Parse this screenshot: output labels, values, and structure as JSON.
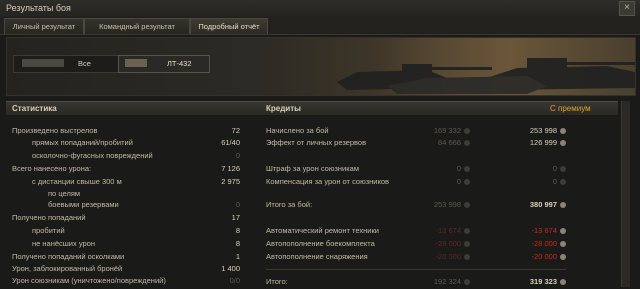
{
  "window": {
    "title": "Результаты боя",
    "close_label": "×"
  },
  "tabs": [
    {
      "label": "Личный результат"
    },
    {
      "label": "Командный результат"
    },
    {
      "label": "Подробный отчёт"
    }
  ],
  "filter": {
    "all_label": "Все",
    "vehicle_label": "ЛТ-432"
  },
  "stats": {
    "heading": "Статистика",
    "rows": [
      {
        "label": "Произведено выстрелов",
        "value": "72"
      },
      {
        "label": "прямых попаданий/пробитий",
        "value": "61/40"
      },
      {
        "label": "осколочно-фугасных повреждений",
        "value": "0"
      },
      {
        "label": "Всего нанесено урона:",
        "value": "7 126"
      },
      {
        "label": "с дистанции свыше 300 м",
        "value": "2 975"
      },
      {
        "label": "по целям",
        "value": ""
      },
      {
        "label": "боевыми резервами",
        "value": "0"
      },
      {
        "label": "Получено попаданий",
        "value": "17"
      },
      {
        "label": "пробитий",
        "value": "8"
      },
      {
        "label": "не нанёсших урон",
        "value": "8"
      },
      {
        "label": "Получено попаданий осколками",
        "value": "1"
      },
      {
        "label": "Урон, заблокированный бронёй",
        "value": "1 400"
      },
      {
        "label": "Урон союзникам (уничтожено/повреждений)",
        "value": "0/0"
      }
    ]
  },
  "credits": {
    "heading": "Кредиты",
    "premium_label": "С премиум",
    "rows": [
      {
        "label": "Начислено за бой",
        "base": "169 332",
        "premium": "253 998"
      },
      {
        "label": "Эффект от личных резервов",
        "base": "84 666",
        "premium": "126 999"
      },
      {
        "label": "Штраф за урон союзникам",
        "base": "0",
        "premium": "0"
      },
      {
        "label": "Компенсация за урон от союзников",
        "base": "0",
        "premium": "0"
      },
      {
        "label": "Итого за бой:",
        "base": "253 998",
        "premium": "380 997"
      },
      {
        "label": "Автоматический ремонт техники",
        "base": "-13 674",
        "premium": "-13 674"
      },
      {
        "label": "Автопополнение боекомплекта",
        "base": "-28 000",
        "premium": "-28 000"
      },
      {
        "label": "Автопополнение снаряжения",
        "base": "-20 000",
        "premium": "-20 000"
      },
      {
        "label": "Итого:",
        "base": "192 324",
        "premium": "319 323"
      }
    ]
  },
  "colors": {
    "accent": "#e0a030",
    "negative": "#c8281c"
  }
}
